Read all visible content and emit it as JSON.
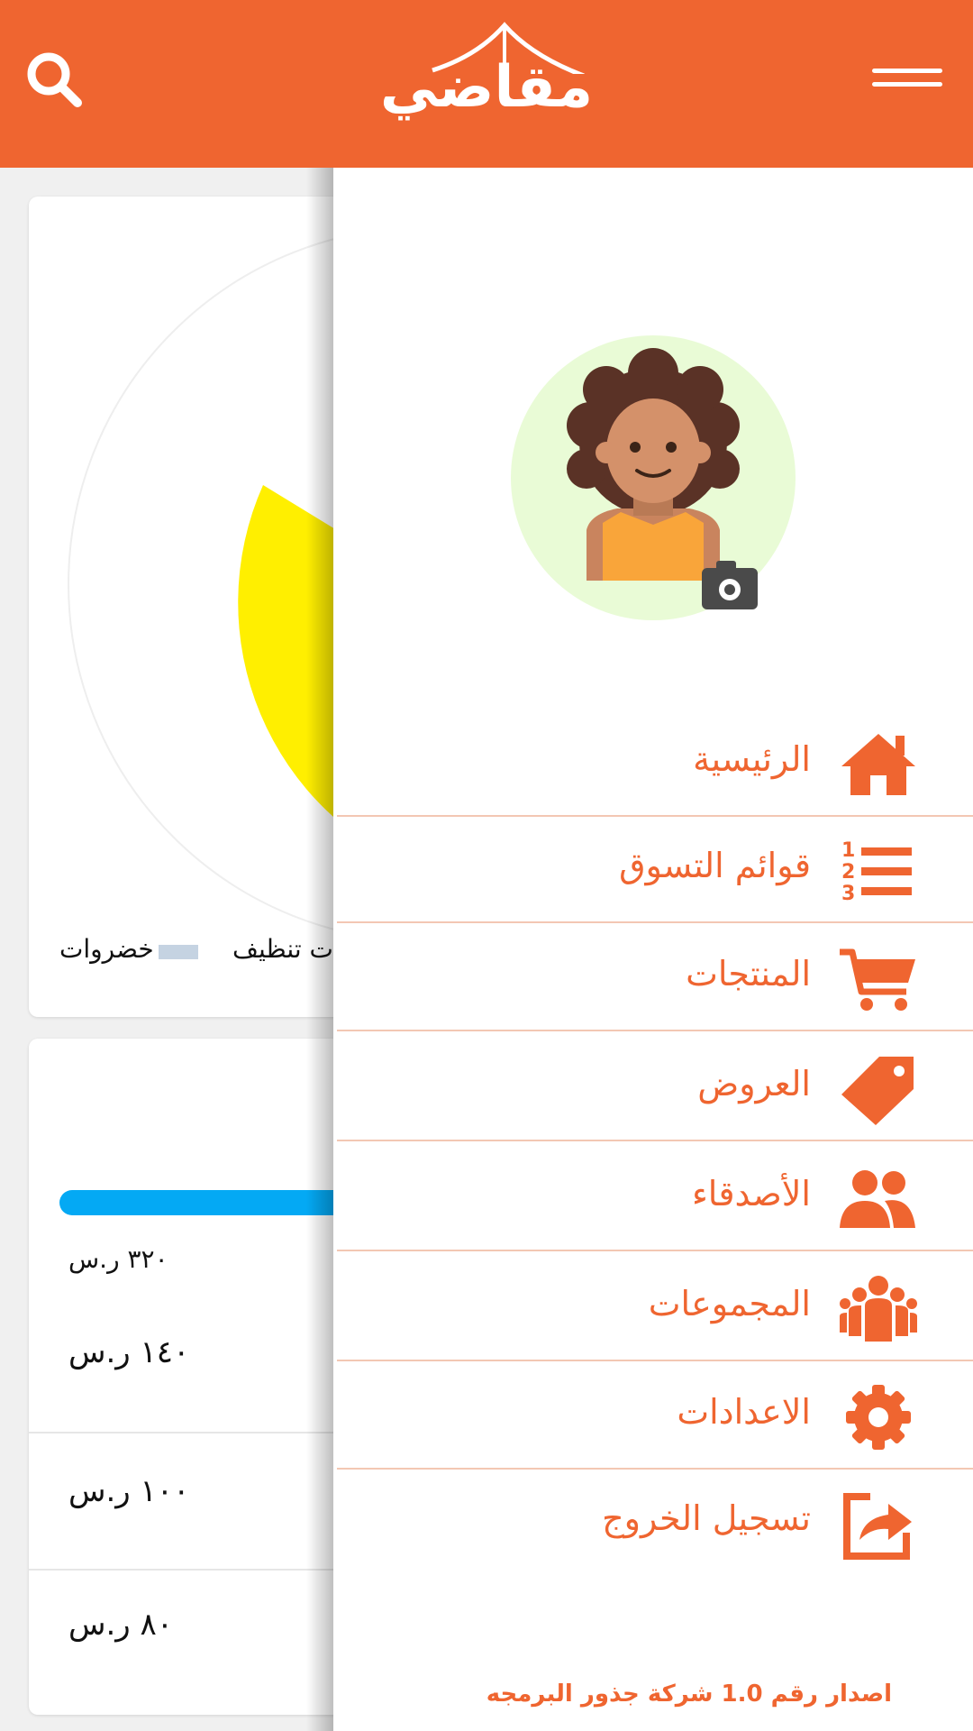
{
  "header": {
    "logo_text": "مقاضي",
    "background_color": "#ef6530"
  },
  "background_content": {
    "legend": [
      {
        "label": "خضروات",
        "color": "#c5d3e2"
      },
      {
        "label": "ت تنظيف"
      }
    ],
    "pie_slice_color": "#ffef00",
    "progress_bar_color": "#04a9f4",
    "prices": [
      "٣٢٠ ر.س",
      "١٤٠ ر.س",
      "١٠٠ ر.س",
      "٨٠ ر.س"
    ]
  },
  "drawer": {
    "menu": [
      {
        "label": "الرئيسية",
        "icon": "home-icon"
      },
      {
        "label": "قوائم التسوق",
        "icon": "numbered-list-icon"
      },
      {
        "label": "المنتجات",
        "icon": "cart-icon"
      },
      {
        "label": "العروض",
        "icon": "tag-icon"
      },
      {
        "label": "الأصدقاء",
        "icon": "friends-icon"
      },
      {
        "label": "المجموعات",
        "icon": "groups-icon"
      },
      {
        "label": "الاعدادات",
        "icon": "gear-icon"
      },
      {
        "label": "تسجيل الخروج",
        "icon": "logout-icon"
      }
    ],
    "version_text": "اصدار رقم 1.0 شركة جذور البرمجه",
    "accent_color": "#ef6530"
  }
}
